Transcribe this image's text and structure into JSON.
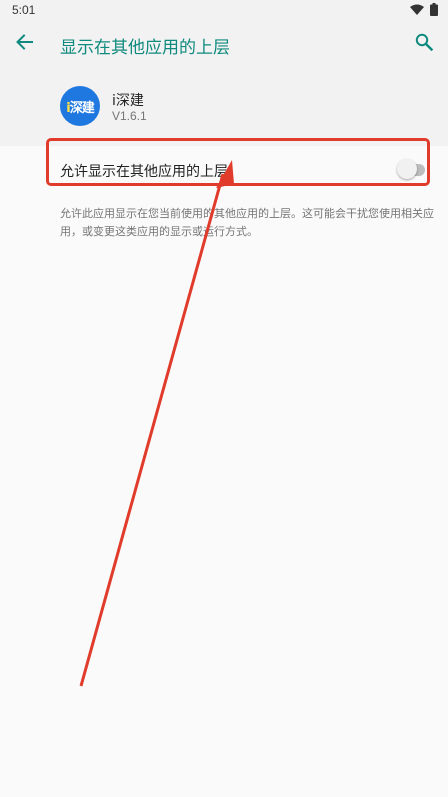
{
  "status_bar": {
    "time": "5:01",
    "icons": [
      "wifi-icon",
      "battery-icon"
    ]
  },
  "app_bar": {
    "title": "显示在其他应用的上层",
    "back_icon": "arrow-back-icon",
    "search_icon": "search-icon",
    "accent_color": "#0f8a7e"
  },
  "app_header": {
    "name": "i深建",
    "version": "V1.6.1",
    "icon_text_main": "i",
    "icon_text_rest": "深建",
    "icon_color": "#1f78e0"
  },
  "preference": {
    "label": "允许显示在其他应用的上层",
    "enabled": false
  },
  "summary": "允许此应用显示在您当前使用的其他应用的上层。这可能会干扰您使用相关应用，或变更这类应用的显示或运行方式。",
  "annotation": {
    "highlight_color": "#e03b2b"
  }
}
